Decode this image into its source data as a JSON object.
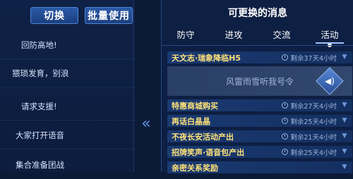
{
  "left_panel": {
    "switch_label": "切换",
    "batch_label": "批量使用",
    "phrases": [
      "回防高地!",
      "猥琐发育，别浪",
      "请求支援!",
      "大家打开语音",
      "集合准备团战"
    ]
  },
  "right_panel": {
    "title": "可更换的消息",
    "tabs": [
      "防守",
      "进攻",
      "交流",
      "活动"
    ],
    "active_tab": "活动",
    "messages": [
      {
        "name": "天文志·瑞象降临H5",
        "remain": "剩余37天4小时"
      },
      {
        "name": "特惠商城购买",
        "remain": "剩余27天4小时"
      },
      {
        "name": "再话白晶晶",
        "remain": "剩余25天4小时"
      },
      {
        "name": "不夜长安活动产出",
        "remain": "剩余21天4小时"
      },
      {
        "name": "招牌笑声·语音包产出",
        "remain": "剩余25天4小时"
      },
      {
        "name": "亲密关系奖励",
        "remain": ""
      }
    ],
    "expanded_text": "风雷雨雪听我号令"
  },
  "icons": {
    "collapse": "double-chevron-left-icon",
    "clock": "clock-icon",
    "chevron": "chevron-down-icon",
    "speaker": "speaker-icon"
  }
}
